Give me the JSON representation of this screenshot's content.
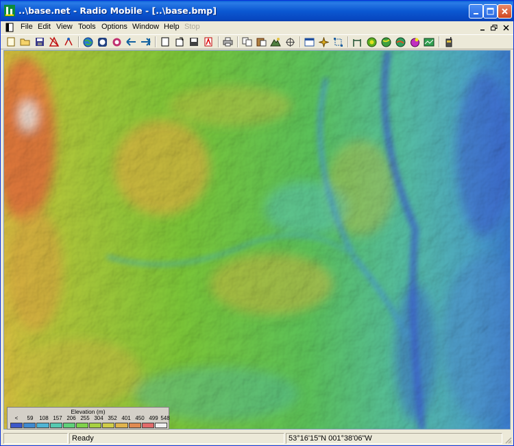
{
  "window": {
    "title": "..\\base.net - Radio Mobile - [..\\base.bmp]",
    "controls": {
      "minimize": "minimize",
      "maximize": "maximize",
      "close": "close"
    }
  },
  "menubar": {
    "items": [
      {
        "id": "file",
        "label": "File",
        "enabled": true
      },
      {
        "id": "edit",
        "label": "Edit",
        "enabled": true
      },
      {
        "id": "view",
        "label": "View",
        "enabled": true
      },
      {
        "id": "tools",
        "label": "Tools",
        "enabled": true
      },
      {
        "id": "options",
        "label": "Options",
        "enabled": true
      },
      {
        "id": "window",
        "label": "Window",
        "enabled": true
      },
      {
        "id": "help",
        "label": "Help",
        "enabled": true
      },
      {
        "id": "stop",
        "label": "Stop",
        "enabled": false
      }
    ]
  },
  "toolbar": {
    "icons": [
      "new-map-icon",
      "open-folder-icon",
      "save-icon",
      "network-properties-icon",
      "unit-properties-icon",
      "globe-icon",
      "map-properties-icon",
      "search-map-icon",
      "go-back-icon",
      "go-forward-icon",
      "new-picture-icon",
      "open-picture-icon",
      "save-picture-icon",
      "pdf-icon",
      "print-icon",
      "copy-icon",
      "paste-icon",
      "terrain-icon",
      "merge-icon",
      "window-icon",
      "compass-icon",
      "fit-icon",
      "antenna-link-icon",
      "radio-coverage-icon",
      "coverage-globe-icon",
      "world-map-icon",
      "3d-view-icon",
      "screen-icon",
      "handheld-radio-icon"
    ]
  },
  "map": {
    "legend": {
      "title": "Elevation (m)",
      "labels": [
        "<",
        "59",
        "108",
        "157",
        "206",
        "255",
        "304",
        "352",
        "401",
        "450",
        "499",
        "548"
      ],
      "colors": [
        "#3a57c8",
        "#3f8ad0",
        "#4fb4d4",
        "#55c9b0",
        "#5fd07a",
        "#7fd24a",
        "#a7d040",
        "#cfcc48",
        "#e0b34c",
        "#e08a50",
        "#e26a6a",
        "#f0f0f0"
      ]
    }
  },
  "statusbar": {
    "message": "Ready",
    "coordinates": "53°16'15\"N 001°38'06\"W"
  }
}
